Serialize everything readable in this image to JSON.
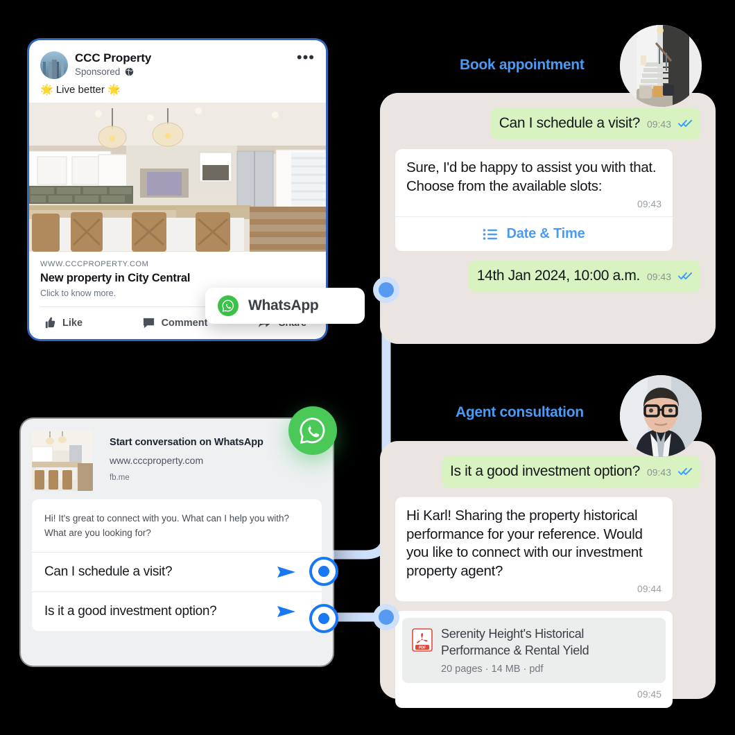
{
  "ad": {
    "page_name": "CCC Property",
    "sponsored_label": "Sponsored",
    "globe_icon": "globe-icon",
    "more_icon": "more-options-icon",
    "caption": "🌟 Live better 🌟",
    "link_url": "WWW.CCCPROPERTY.COM",
    "link_title": "New property in City Central",
    "link_desc": "Click to know more.",
    "actions": [
      {
        "label": "Like",
        "icon": "thumbs-up-icon"
      },
      {
        "label": "Comment",
        "icon": "comment-icon"
      },
      {
        "label": "Share",
        "icon": "share-icon"
      }
    ],
    "cta_pill": {
      "label": "WhatsApp",
      "icon": "whatsapp-icon"
    }
  },
  "entry_card": {
    "title": "Start conversation on WhatsApp",
    "url": "www.cccproperty.com",
    "source": "fb.me",
    "greeting": "Hi! It's great to connect with you. What can I help you with? What are you looking for?",
    "options": [
      {
        "label": "Can I schedule a visit?",
        "icon": "send-icon"
      },
      {
        "label": "Is it a good investment option?",
        "icon": "send-icon"
      }
    ],
    "float_icon": "whatsapp-icon"
  },
  "book_appointment": {
    "title": "Book appointment",
    "avatar": "property-interior-avatar",
    "messages": [
      {
        "type": "outgoing",
        "text": "Can I schedule a visit?",
        "time": "09:43",
        "status": "read-ticks-icon"
      },
      {
        "type": "incoming_card",
        "text": "Sure, I'd be happy to assist you with that. Choose from the available slots:",
        "time": "09:43",
        "action_label": "Date & Time",
        "action_icon": "list-icon"
      },
      {
        "type": "outgoing",
        "text": "14th Jan 2024, 10:00 a.m.",
        "time": "09:43",
        "status": "read-ticks-icon"
      }
    ]
  },
  "agent_consultation": {
    "title": "Agent consultation",
    "avatar": "agent-portrait-avatar",
    "messages": [
      {
        "type": "outgoing",
        "text": "Is it a good investment option?",
        "time": "09:43",
        "status": "read-ticks-icon"
      },
      {
        "type": "incoming",
        "text": "Hi Karl! Sharing the property historical performance for your reference. Would you like to connect with our investment property agent?",
        "time": "09:44"
      },
      {
        "type": "document",
        "name": "Serenity Height's Historical Performance & Rental Yield",
        "meta": "20 pages · 14 MB · pdf",
        "time": "09:45",
        "icon": "pdf-file-icon"
      }
    ]
  },
  "colors": {
    "accent_blue": "#4A9BF5",
    "fb_blue": "#1877F2",
    "whatsapp_green": "#4AC959",
    "bubble_green": "#D9F2C2",
    "panel_beige": "#EAE5E0",
    "connector_blue": "#CFE0FB"
  }
}
